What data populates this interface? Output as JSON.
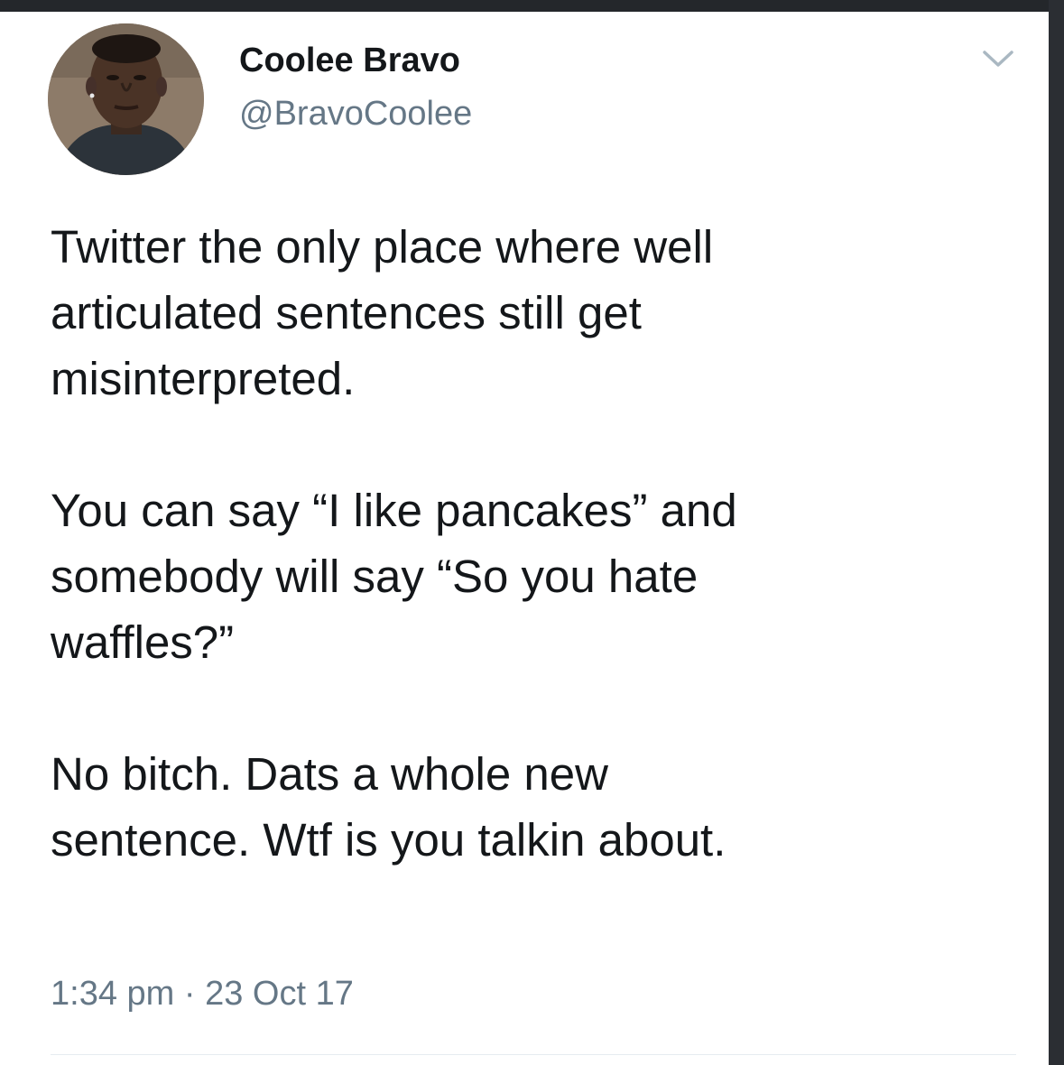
{
  "tweet": {
    "author": {
      "display_name": "Coolee Bravo",
      "handle": "@BravoCoolee"
    },
    "body": {
      "paragraphs": [
        [
          "Twitter the only place where well",
          "articulated sentences still get",
          "misinterpreted."
        ],
        [
          "You can say “I like pancakes” and",
          "somebody will say “So you hate",
          "waffles?”"
        ],
        [
          "No bitch. Dats a whole new",
          "sentence. Wtf is you talkin about."
        ]
      ]
    },
    "time": "1:34 pm",
    "separator": "·",
    "date": "23 Oct 17"
  },
  "icons": {
    "menu": "chevron-down-icon"
  },
  "colors": {
    "text": "#14171a",
    "secondary_text": "#657786",
    "caret": "#aab8c2",
    "divider": "#e6ecf0"
  }
}
